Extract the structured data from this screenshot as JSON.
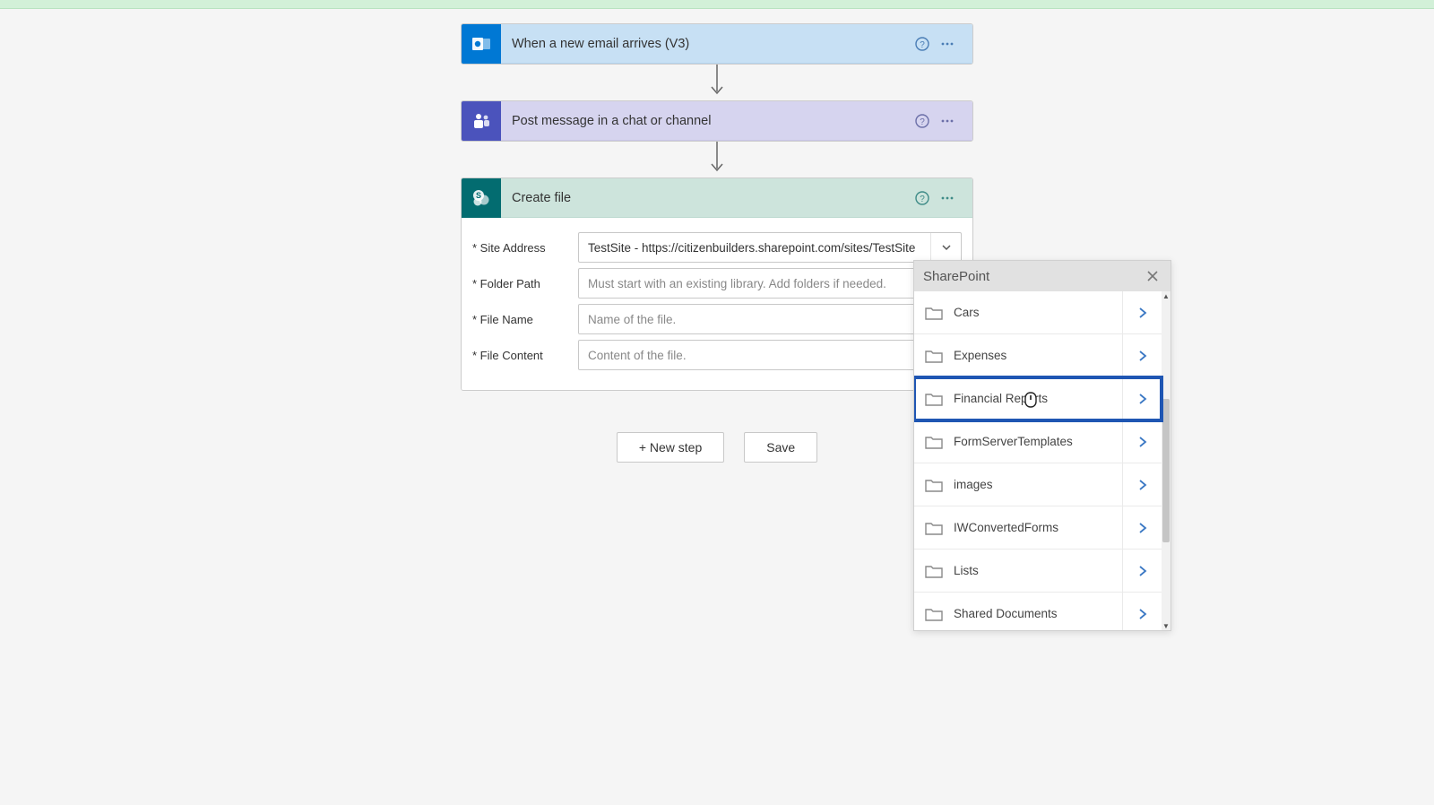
{
  "trigger": {
    "title": "When a new email arrives (V3)"
  },
  "teams_action": {
    "title": "Post message in a chat or channel"
  },
  "sp_action": {
    "title": "Create file",
    "fields": {
      "site_address": {
        "label": "* Site Address",
        "value": "TestSite - https://citizenbuilders.sharepoint.com/sites/TestSite"
      },
      "folder_path": {
        "label": "* Folder Path",
        "placeholder": "Must start with an existing library. Add folders if needed."
      },
      "file_name": {
        "label": "* File Name",
        "placeholder": "Name of the file."
      },
      "file_content": {
        "label": "* File Content",
        "placeholder": "Content of the file."
      }
    }
  },
  "buttons": {
    "new_step": "+ New step",
    "save": "Save"
  },
  "picker": {
    "title": "SharePoint",
    "folders": [
      "Cars",
      "Expenses",
      "Financial Reports",
      "FormServerTemplates",
      "images",
      "IWConvertedForms",
      "Lists",
      "Shared Documents"
    ],
    "highlight_index": 2
  }
}
